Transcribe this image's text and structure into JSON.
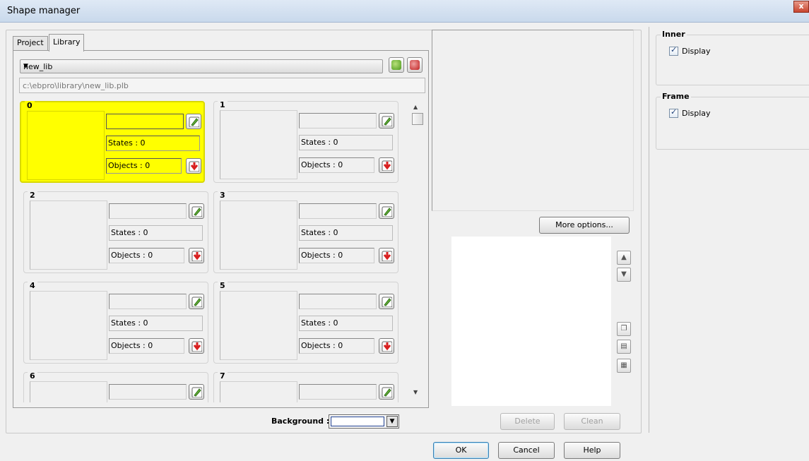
{
  "window": {
    "title": "Shape manager",
    "close_label": "x"
  },
  "tabs": [
    {
      "label": "Project",
      "selected": false
    },
    {
      "label": "Library",
      "selected": true
    }
  ],
  "library": {
    "selected": "new_lib",
    "path": "c:\\ebpro\\library\\new_lib.plb"
  },
  "shapes": [
    {
      "index": "0",
      "states": "States : 0",
      "objects": "Objects : 0",
      "selected": true
    },
    {
      "index": "1",
      "states": "States : 0",
      "objects": "Objects : 0"
    },
    {
      "index": "2",
      "states": "States : 0",
      "objects": "Objects : 0"
    },
    {
      "index": "3",
      "states": "States : 0",
      "objects": "Objects : 0"
    },
    {
      "index": "4",
      "states": "States : 0",
      "objects": "Objects : 0"
    },
    {
      "index": "5",
      "states": "States : 0",
      "objects": "Objects : 0"
    },
    {
      "index": "6"
    },
    {
      "index": "7"
    }
  ],
  "background": {
    "label": "Background :",
    "color": "#ffffff"
  },
  "buttons": {
    "more_options": "More options...",
    "delete": "Delete",
    "clean": "Clean",
    "ok": "OK",
    "cancel": "Cancel",
    "help": "Help"
  },
  "inner": {
    "title": "Inner",
    "display_label": "Display",
    "display_checked": true
  },
  "frame": {
    "title": "Frame",
    "display_label": "Display",
    "display_checked": true
  },
  "colors": {
    "selected_cell": "#ffff00",
    "background": "#f0f0f0"
  }
}
